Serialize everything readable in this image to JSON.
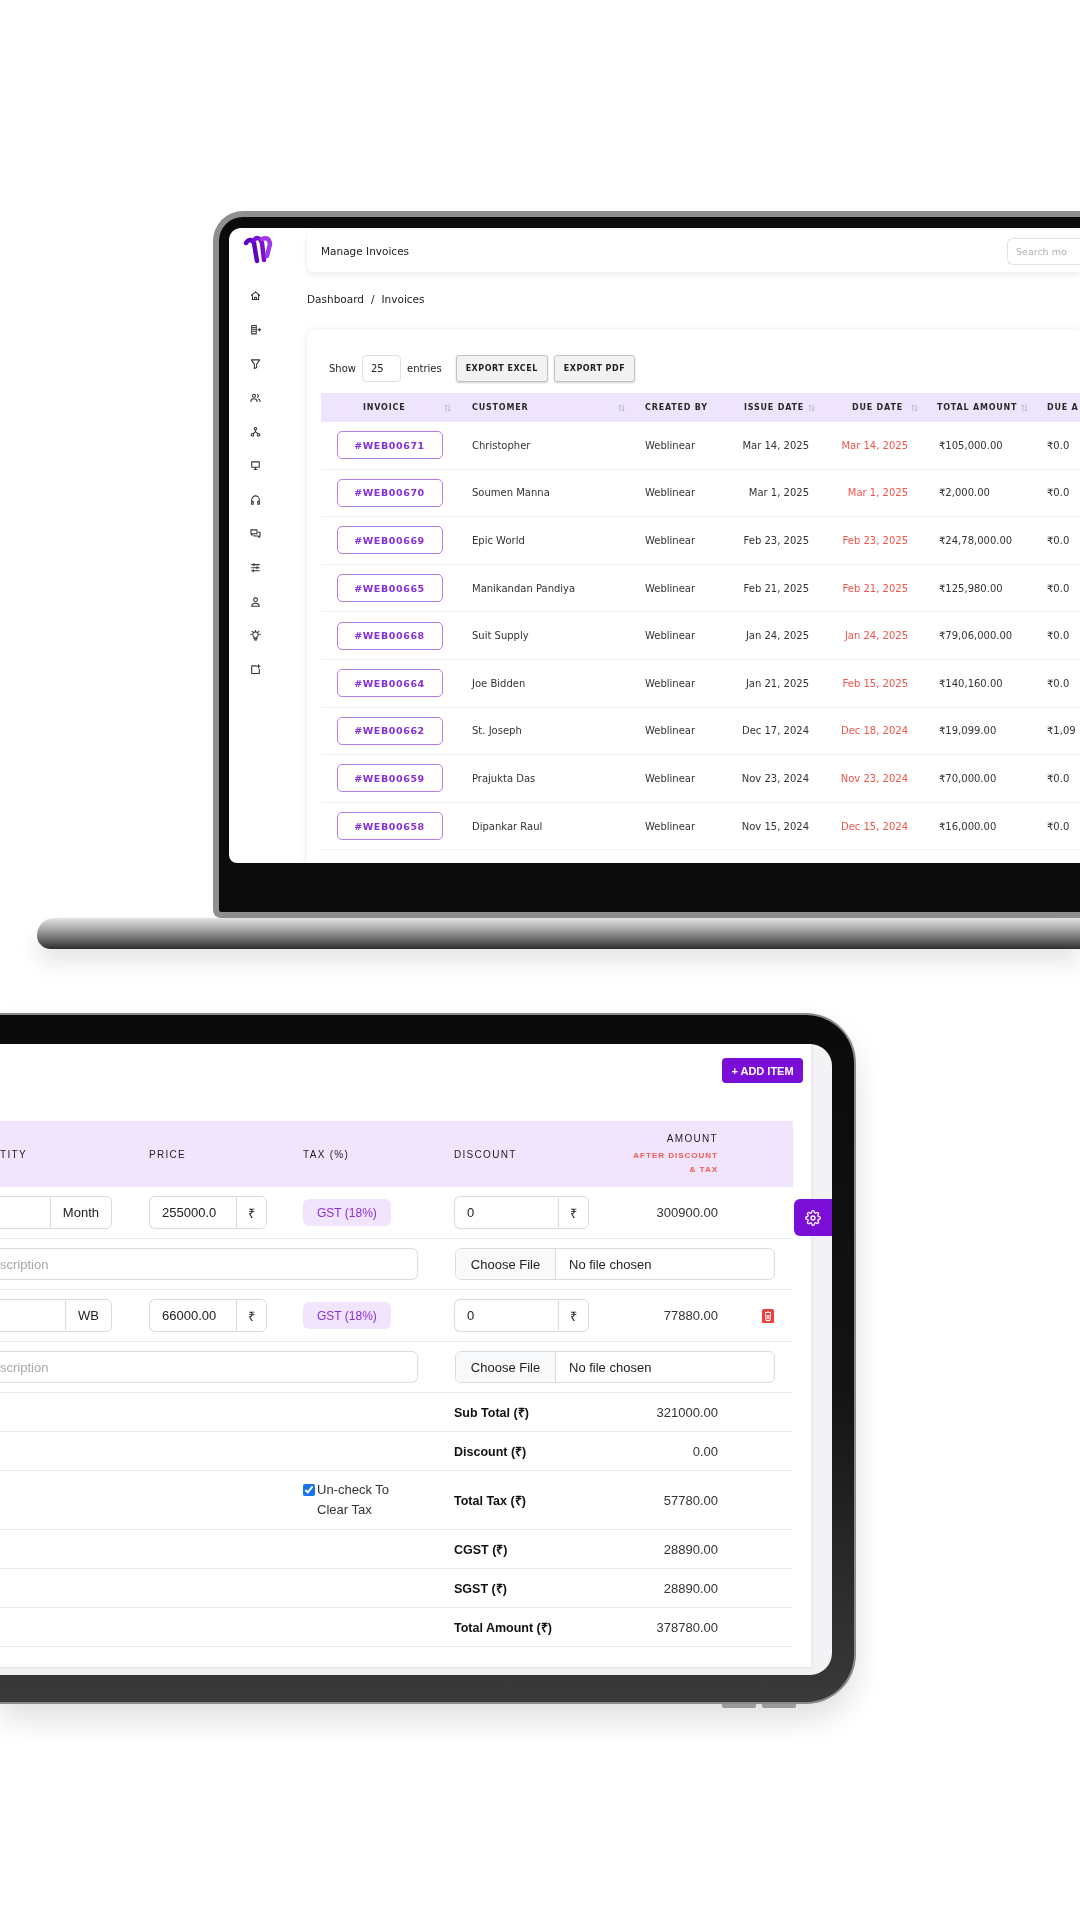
{
  "laptop": {
    "header": {
      "title": "Manage Invoices",
      "search": {
        "placeholder": "Search mo"
      }
    },
    "breadcrumb": {
      "items": [
        "Dashboard",
        "Invoices"
      ],
      "separator": "/"
    },
    "entries": {
      "prefix": "Show",
      "value": "25",
      "suffix": "entries"
    },
    "buttons": [
      "EXPORT EXCEL",
      "EXPORT PDF"
    ],
    "table": {
      "columns": [
        {
          "label": "INVOICE",
          "sortable": true
        },
        {
          "label": "CUSTOMER",
          "sortable": true
        },
        {
          "label": "CREATED BY",
          "sortable": false
        },
        {
          "label": "ISSUE DATE",
          "sortable": true
        },
        {
          "label": "DUE DATE",
          "sortable": true
        },
        {
          "label": "TOTAL AMOUNT",
          "sortable": true
        },
        {
          "label": "DUE A"
        }
      ],
      "rows": [
        {
          "invoice": "#WEB00671",
          "customer": "Christopher",
          "created_by": "Weblinear",
          "issue_date": "Mar 14, 2025",
          "due_date": "Mar 14, 2025",
          "overdue": true,
          "total_amount": "₹105,000.00",
          "due_amount": "₹0.0"
        },
        {
          "invoice": "#WEB00670",
          "customer": "Soumen Manna",
          "created_by": "Weblinear",
          "issue_date": "Mar 1, 2025",
          "due_date": "Mar 1, 2025",
          "overdue": true,
          "total_amount": "₹2,000.00",
          "due_amount": "₹0.0"
        },
        {
          "invoice": "#WEB00669",
          "customer": "Epic World",
          "created_by": "Weblinear",
          "issue_date": "Feb 23, 2025",
          "due_date": "Feb 23, 2025",
          "overdue": true,
          "total_amount": "₹24,78,000.00",
          "due_amount": "₹0.0"
        },
        {
          "invoice": "#WEB00665",
          "customer": "Manikandan Pandiya",
          "created_by": "Weblinear",
          "issue_date": "Feb 21, 2025",
          "due_date": "Feb 21, 2025",
          "overdue": true,
          "total_amount": "₹125,980.00",
          "due_amount": "₹0.0"
        },
        {
          "invoice": "#WEB00668",
          "customer": "Suit Supply",
          "created_by": "Weblinear",
          "issue_date": "Jan 24, 2025",
          "due_date": "Jan 24, 2025",
          "overdue": true,
          "total_amount": "₹79,06,000.00",
          "due_amount": "₹0.0"
        },
        {
          "invoice": "#WEB00664",
          "customer": "Joe Bidden",
          "created_by": "Weblinear",
          "issue_date": "Jan 21, 2025",
          "due_date": "Feb 15, 2025",
          "overdue": true,
          "total_amount": "₹140,160.00",
          "due_amount": "₹0.0"
        },
        {
          "invoice": "#WEB00662",
          "customer": "St. Joseph",
          "created_by": "Weblinear",
          "issue_date": "Dec 17, 2024",
          "due_date": "Dec 18, 2024",
          "overdue": true,
          "total_amount": "₹19,099.00",
          "due_amount": "₹1,09"
        },
        {
          "invoice": "#WEB00659",
          "customer": "Prajukta Das",
          "created_by": "Weblinear",
          "issue_date": "Nov 23, 2024",
          "due_date": "Nov 23, 2024",
          "overdue": true,
          "total_amount": "₹70,000.00",
          "due_amount": "₹0.0"
        },
        {
          "invoice": "#WEB00658",
          "customer": "Dipankar Raul",
          "created_by": "Weblinear",
          "issue_date": "Nov 15, 2024",
          "due_date": "Dec 15, 2024",
          "overdue": true,
          "total_amount": "₹16,000.00",
          "due_amount": "₹0.0"
        }
      ]
    }
  },
  "tablet": {
    "add_button": "+ ADD ITEM",
    "columns": [
      {
        "label": "TITY"
      },
      {
        "label": "PRICE"
      },
      {
        "label": "TAX (%)"
      },
      {
        "label": "DISCOUNT"
      },
      {
        "label": "AMOUNT",
        "note": "AFTER DISCOUNT & TAX"
      }
    ],
    "items": [
      {
        "unit": "Month",
        "price": "255000.0",
        "price_currency": "₹",
        "tax": "GST (18%)",
        "discount": "0",
        "discount_currency": "₹",
        "amount": "300900.00",
        "deletable": false,
        "description": {
          "placeholder": "scription"
        },
        "attachment": {
          "button": "Choose File",
          "status": "No file chosen"
        }
      },
      {
        "unit": "WB",
        "price": "66000.00",
        "price_currency": "₹",
        "tax": "GST (18%)",
        "discount": "0",
        "discount_currency": "₹",
        "amount": "77880.00",
        "deletable": true,
        "description": {
          "placeholder": "scription"
        },
        "attachment": {
          "button": "Choose File",
          "status": "No file chosen"
        }
      }
    ],
    "summary": [
      {
        "label": "Sub Total (₹)",
        "value": "321000.00"
      },
      {
        "label": "Discount (₹)",
        "value": "0.00"
      },
      {
        "label": "Total Tax (₹)",
        "value": "57780.00",
        "toggle": {
          "label": "Un-check To Clear Tax",
          "checked": true
        }
      },
      {
        "label": "CGST (₹)",
        "value": "28890.00"
      },
      {
        "label": "SGST (₹)",
        "value": "28890.00"
      },
      {
        "label": "Total Amount (₹)",
        "value": "378780.00"
      }
    ]
  }
}
